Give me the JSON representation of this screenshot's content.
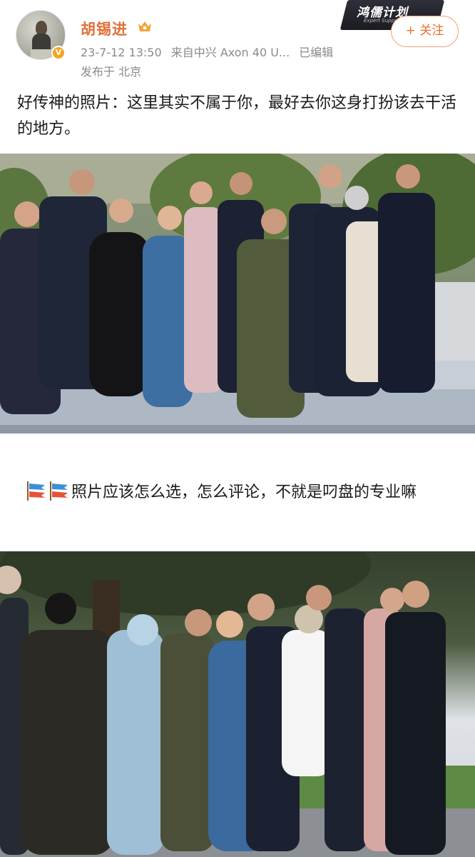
{
  "post": {
    "username": "胡锡进",
    "timestamp": "23-7-12 13:50",
    "source": "来自中兴 Axon 40 U...",
    "edited": "已编辑",
    "location": "发布于 北京",
    "follow_label": "+ 关注",
    "watermark": "鸿儒计划",
    "watermark_sub": "Expert Support Program",
    "text": "好传神的照片：这里其实不属于你，最好去你这身打扮该去干活的地方。"
  },
  "comment": {
    "text": "照片应该怎么选，怎么评论，不就是叼盘的专业嘛"
  },
  "icons": {
    "avatar": "user-avatar",
    "verified": "verified-badge-icon",
    "member": "member-crown-icon",
    "emoji": "koinobori-fish-emoji"
  },
  "colors": {
    "username": "#e0703a",
    "follow": "#e8702f",
    "meta": "#8a8a8a"
  }
}
